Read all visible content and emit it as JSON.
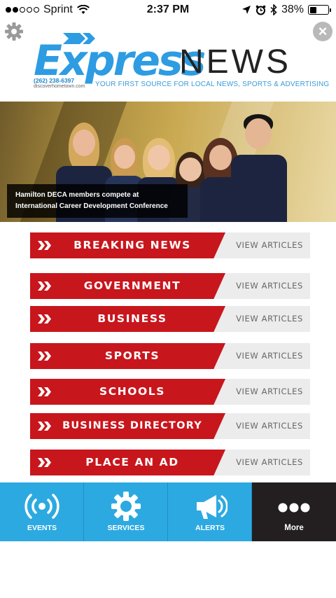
{
  "status_bar": {
    "carrier": "Sprint",
    "time": "2:37 PM",
    "battery": "38%",
    "battery_level": 0.38
  },
  "header": {
    "logo_primary": "Express",
    "logo_secondary": "NEWS",
    "phone": "(262) 238-6397",
    "website": "discoverhometown.com",
    "tagline": "YOUR FIRST SOURCE FOR LOCAL NEWS, SPORTS & ADVERTISING",
    "settings_icon": "gear-icon",
    "close_icon": "close-icon",
    "brand_blue": "#2d9ce2"
  },
  "hero": {
    "caption_line1": "Hamilton DECA members compete at",
    "caption_line2": "International Career Development Conference"
  },
  "sections": [
    {
      "label": "BREAKING NEWS",
      "action": "VIEW ARTICLES"
    },
    {
      "label": "GOVERNMENT",
      "action": "VIEW ARTICLES"
    },
    {
      "label": "BUSINESS",
      "action": "VIEW ARTICLES"
    },
    {
      "label": "SPORTS",
      "action": "VIEW ARTICLES"
    },
    {
      "label": "SCHOOLS",
      "action": "VIEW ARTICLES"
    },
    {
      "label": "BUSINESS DIRECTORY",
      "action": "VIEW ARTICLES"
    },
    {
      "label": "PLACE AN AD",
      "action": "VIEW ARTICLES"
    }
  ],
  "section_colors": {
    "red": "#c8161d",
    "grey": "#ececec"
  },
  "tabbar": {
    "tabs": [
      {
        "label": "EVENTS",
        "icon": "broadcast-icon"
      },
      {
        "label": "SERVICES",
        "icon": "gear-icon"
      },
      {
        "label": "ALERTS",
        "icon": "megaphone-icon"
      },
      {
        "label": "More",
        "icon": "more-dots-icon"
      }
    ],
    "active_color": "#2da9e1",
    "more_color": "#231f20"
  }
}
